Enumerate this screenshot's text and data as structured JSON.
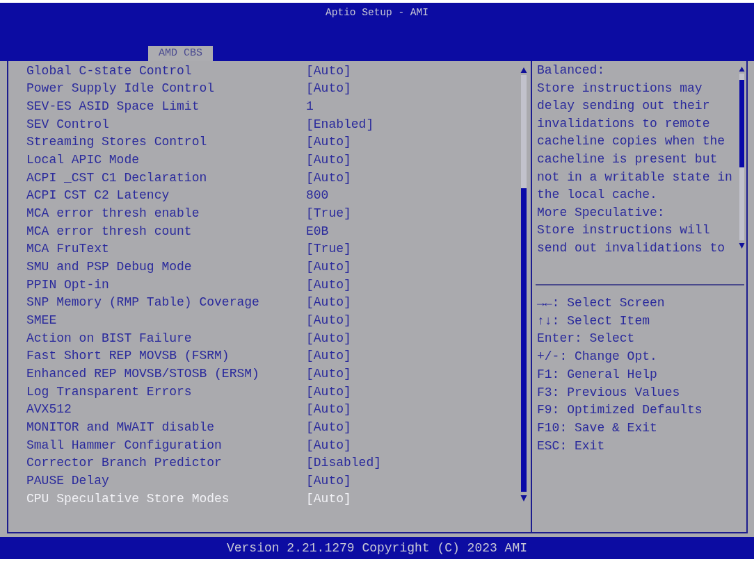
{
  "window": {
    "title": "Aptio Setup - AMI"
  },
  "tabs": [
    {
      "label": "AMD CBS",
      "selected": true
    }
  ],
  "settings": [
    {
      "label": "Global C-state Control",
      "value": "[Auto]",
      "selected": false
    },
    {
      "label": "Power Supply Idle Control",
      "value": "[Auto]",
      "selected": false
    },
    {
      "label": "SEV-ES ASID Space Limit",
      "value": "1",
      "selected": false
    },
    {
      "label": "SEV Control",
      "value": "[Enabled]",
      "selected": false
    },
    {
      "label": "Streaming Stores Control",
      "value": "[Auto]",
      "selected": false
    },
    {
      "label": "Local APIC Mode",
      "value": "[Auto]",
      "selected": false
    },
    {
      "label": "ACPI _CST C1 Declaration",
      "value": "[Auto]",
      "selected": false
    },
    {
      "label": "ACPI CST C2 Latency",
      "value": "800",
      "selected": false
    },
    {
      "label": "MCA error thresh enable",
      "value": "[True]",
      "selected": false
    },
    {
      "label": "MCA error thresh count",
      "value": "E0B",
      "selected": false
    },
    {
      "label": "MCA FruText",
      "value": "[True]",
      "selected": false
    },
    {
      "label": "SMU and PSP Debug Mode",
      "value": "[Auto]",
      "selected": false
    },
    {
      "label": "PPIN Opt-in",
      "value": "[Auto]",
      "selected": false
    },
    {
      "label": "SNP Memory (RMP Table) Coverage",
      "value": "[Auto]",
      "selected": false
    },
    {
      "label": "SMEE",
      "value": "[Auto]",
      "selected": false
    },
    {
      "label": "Action on BIST Failure",
      "value": "[Auto]",
      "selected": false
    },
    {
      "label": "Fast Short REP MOVSB (FSRM)",
      "value": "[Auto]",
      "selected": false
    },
    {
      "label": "Enhanced REP MOVSB/STOSB (ERSM)",
      "value": "[Auto]",
      "selected": false
    },
    {
      "label": "Log Transparent Errors",
      "value": "[Auto]",
      "selected": false
    },
    {
      "label": "AVX512",
      "value": "[Auto]",
      "selected": false
    },
    {
      "label": "MONITOR and MWAIT disable",
      "value": "[Auto]",
      "selected": false
    },
    {
      "label": "Small Hammer Configuration",
      "value": "[Auto]",
      "selected": false
    },
    {
      "label": "Corrector Branch Predictor",
      "value": "[Disabled]",
      "selected": false
    },
    {
      "label": "PAUSE Delay",
      "value": "[Auto]",
      "selected": false
    },
    {
      "label": "CPU Speculative Store Modes",
      "value": "[Auto]",
      "selected": true
    }
  ],
  "help": {
    "paragraphs": [
      "Balanced:",
      "Store instructions may delay sending out their invalidations to remote cacheline copies when the cacheline is present but not in a writable state in the local cache.",
      "More Speculative:",
      "Store instructions will send out invalidations to"
    ]
  },
  "key_hints": [
    "→←: Select Screen",
    "↑↓: Select Item",
    "Enter: Select",
    "+/-: Change Opt.",
    "F1: General Help",
    "F3: Previous Values",
    "F9: Optimized Defaults",
    "F10: Save & Exit",
    "ESC: Exit"
  ],
  "status_bar": {
    "text": "Version 2.21.1279 Copyright (C) 2023 AMI"
  }
}
